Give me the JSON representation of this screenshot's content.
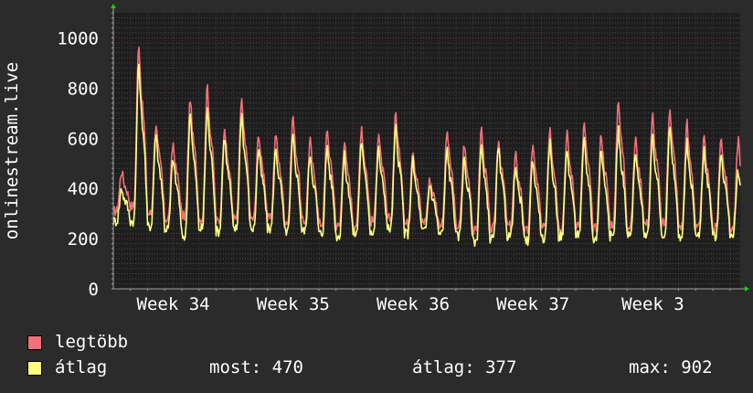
{
  "chart_data": {
    "type": "line",
    "ylabel": "onlinestream.live",
    "ylim": [
      0,
      1100
    ],
    "yticks": [
      0,
      200,
      400,
      600,
      800,
      1000
    ],
    "xticks": [
      "Week 34",
      "Week 35",
      "Week 36",
      "Week 37",
      "Week 3"
    ],
    "grid": true,
    "x_unit": "day",
    "x_start": 0,
    "x_end": 36.6,
    "series": [
      {
        "name": "legtöbb",
        "color": "#f2707a",
        "peaks": [
          470,
          980,
          660,
          580,
          760,
          810,
          650,
          760,
          620,
          620,
          690,
          590,
          640,
          590,
          650,
          620,
          700,
          560,
          440,
          630,
          580,
          640,
          600,
          530,
          580,
          650,
          620,
          660,
          620,
          760,
          600,
          690,
          730,
          660,
          600,
          610,
          600
        ],
        "troughs": [
          310,
          330,
          300,
          280,
          290,
          280,
          270,
          280,
          280,
          280,
          270,
          270,
          260,
          250,
          260,
          270,
          280,
          260,
          270,
          260,
          250,
          230,
          240,
          250,
          230,
          240,
          250,
          260,
          240,
          260,
          250,
          260,
          260,
          250,
          240,
          240,
          240
        ]
      },
      {
        "name": "átlag",
        "color": "#ffff80",
        "peaks": [
          400,
          900,
          620,
          520,
          710,
          720,
          610,
          700,
          560,
          560,
          610,
          540,
          570,
          530,
          590,
          560,
          640,
          510,
          420,
          560,
          520,
          570,
          560,
          480,
          520,
          580,
          560,
          590,
          560,
          640,
          540,
          610,
          640,
          580,
          560,
          550,
          470
        ],
        "troughs": [
          270,
          270,
          250,
          240,
          210,
          240,
          230,
          240,
          240,
          240,
          230,
          230,
          220,
          210,
          220,
          230,
          240,
          220,
          230,
          220,
          210,
          190,
          200,
          210,
          190,
          200,
          210,
          220,
          200,
          210,
          210,
          220,
          220,
          210,
          210,
          210,
          220
        ]
      }
    ]
  },
  "legend": {
    "max_label": "legtöbb",
    "avg_label": "átlag",
    "stats": {
      "now": "most: 470",
      "avg": "átlag: 377",
      "max": "max: 902"
    }
  }
}
